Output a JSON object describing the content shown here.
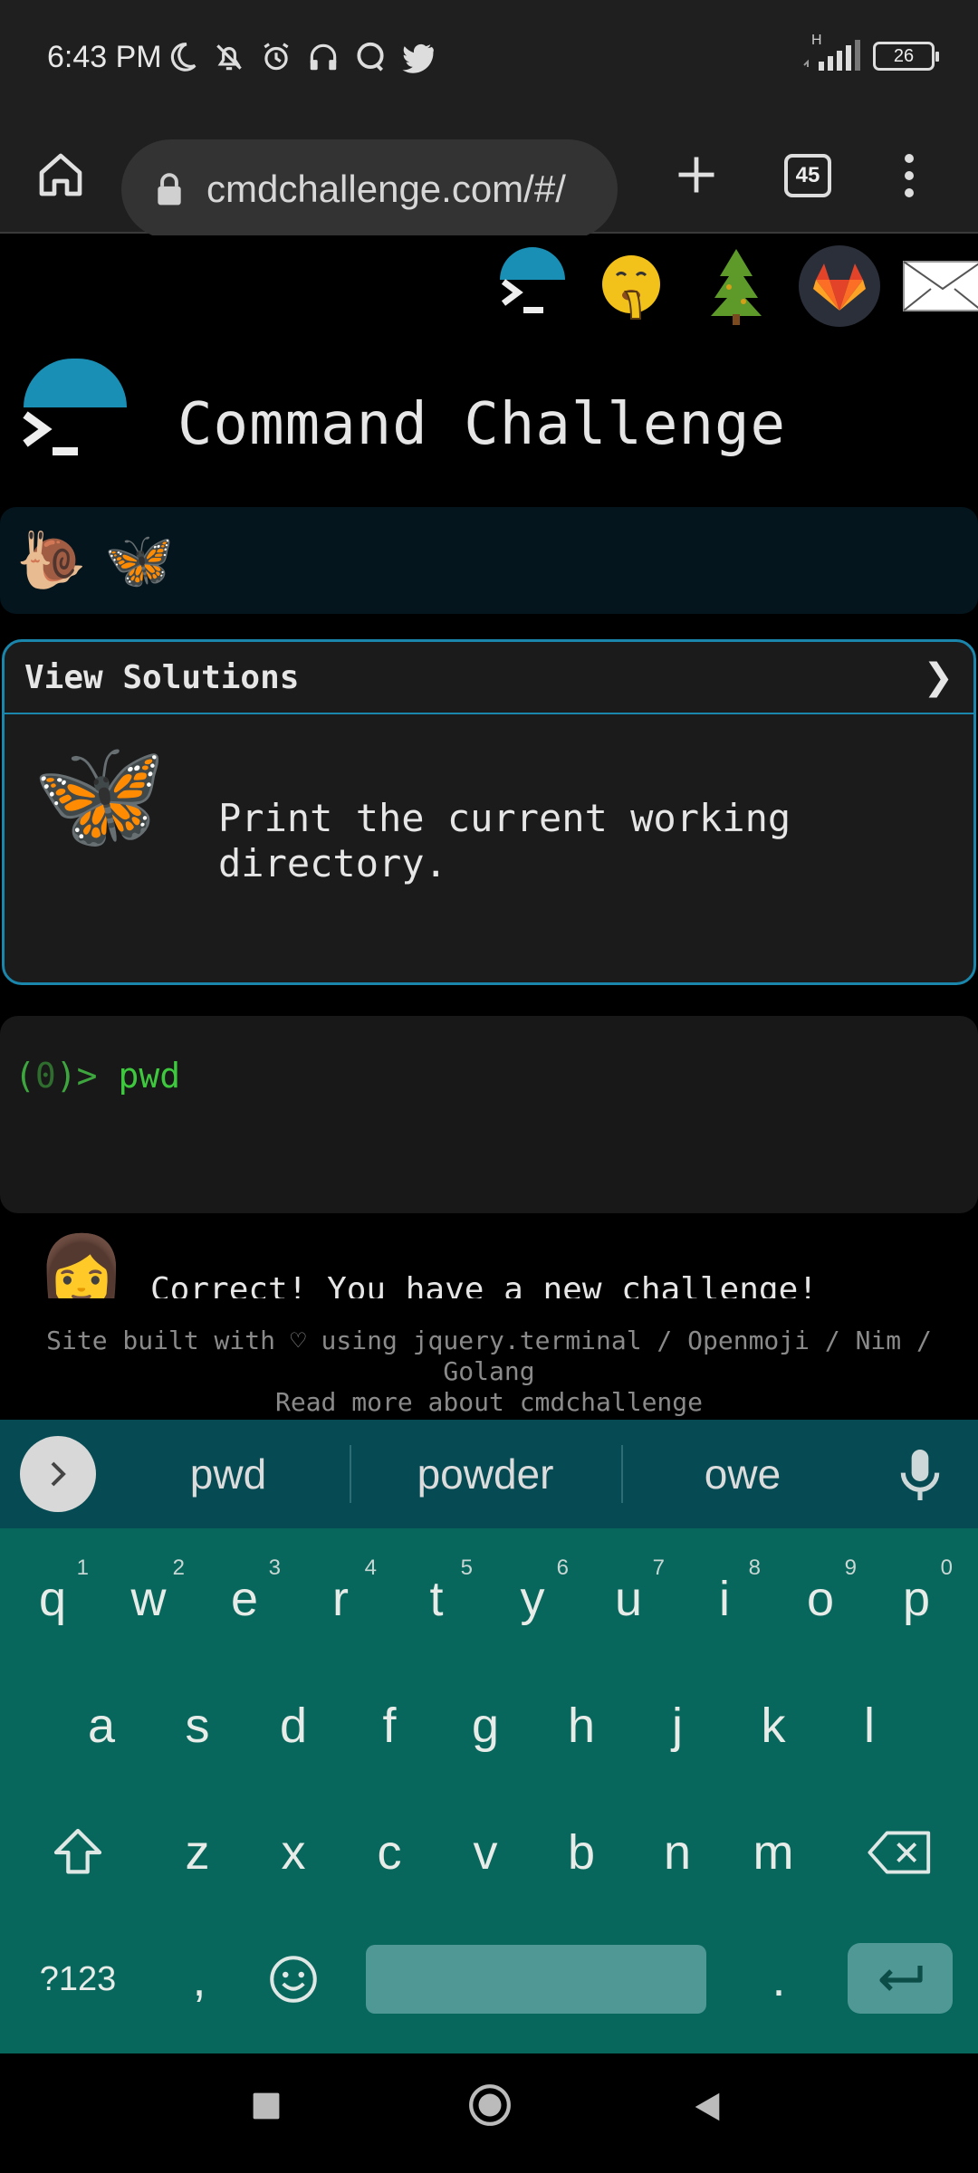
{
  "status_bar": {
    "time": "6:43 PM",
    "network_label": "H",
    "battery_level": "26"
  },
  "browser": {
    "url": "cmdchallenge.com/#/",
    "tab_count": "45"
  },
  "page": {
    "title": "Command Challenge",
    "progress_emojis": [
      "🐌",
      "🦋"
    ],
    "solutions_label": "View Solutions",
    "solutions_chevron": "❯",
    "challenge_emoji": "🦋",
    "challenge_text": "Print the current working directory.",
    "terminal": {
      "prompt_open": "(",
      "prompt_num": "0",
      "prompt_close": ")>",
      "command": "pwd"
    },
    "correct_emoji": "👩",
    "correct_message": "Correct! You have a new challenge!",
    "footer_line1": "Site built with ♡ using jquery.terminal / Openmoji / Nim / Golang",
    "footer_line2": "Read more about cmdchallenge"
  },
  "keyboard": {
    "suggestions": [
      "pwd",
      "powder",
      "owe"
    ],
    "row1": [
      {
        "key": "q",
        "alt": "1"
      },
      {
        "key": "w",
        "alt": "2"
      },
      {
        "key": "e",
        "alt": "3"
      },
      {
        "key": "r",
        "alt": "4"
      },
      {
        "key": "t",
        "alt": "5"
      },
      {
        "key": "y",
        "alt": "6"
      },
      {
        "key": "u",
        "alt": "7"
      },
      {
        "key": "i",
        "alt": "8"
      },
      {
        "key": "o",
        "alt": "9"
      },
      {
        "key": "p",
        "alt": "0"
      }
    ],
    "row2": [
      "a",
      "s",
      "d",
      "f",
      "g",
      "h",
      "j",
      "k",
      "l"
    ],
    "row3": [
      "z",
      "x",
      "c",
      "v",
      "b",
      "n",
      "m"
    ],
    "symbols_label": "?123",
    "comma": ",",
    "period": "."
  },
  "colors": {
    "accent": "#1a86ac",
    "terminal_green": "#3ec83e",
    "keyboard_bg": "#08675d",
    "suggestion_bg": "#064b53"
  }
}
